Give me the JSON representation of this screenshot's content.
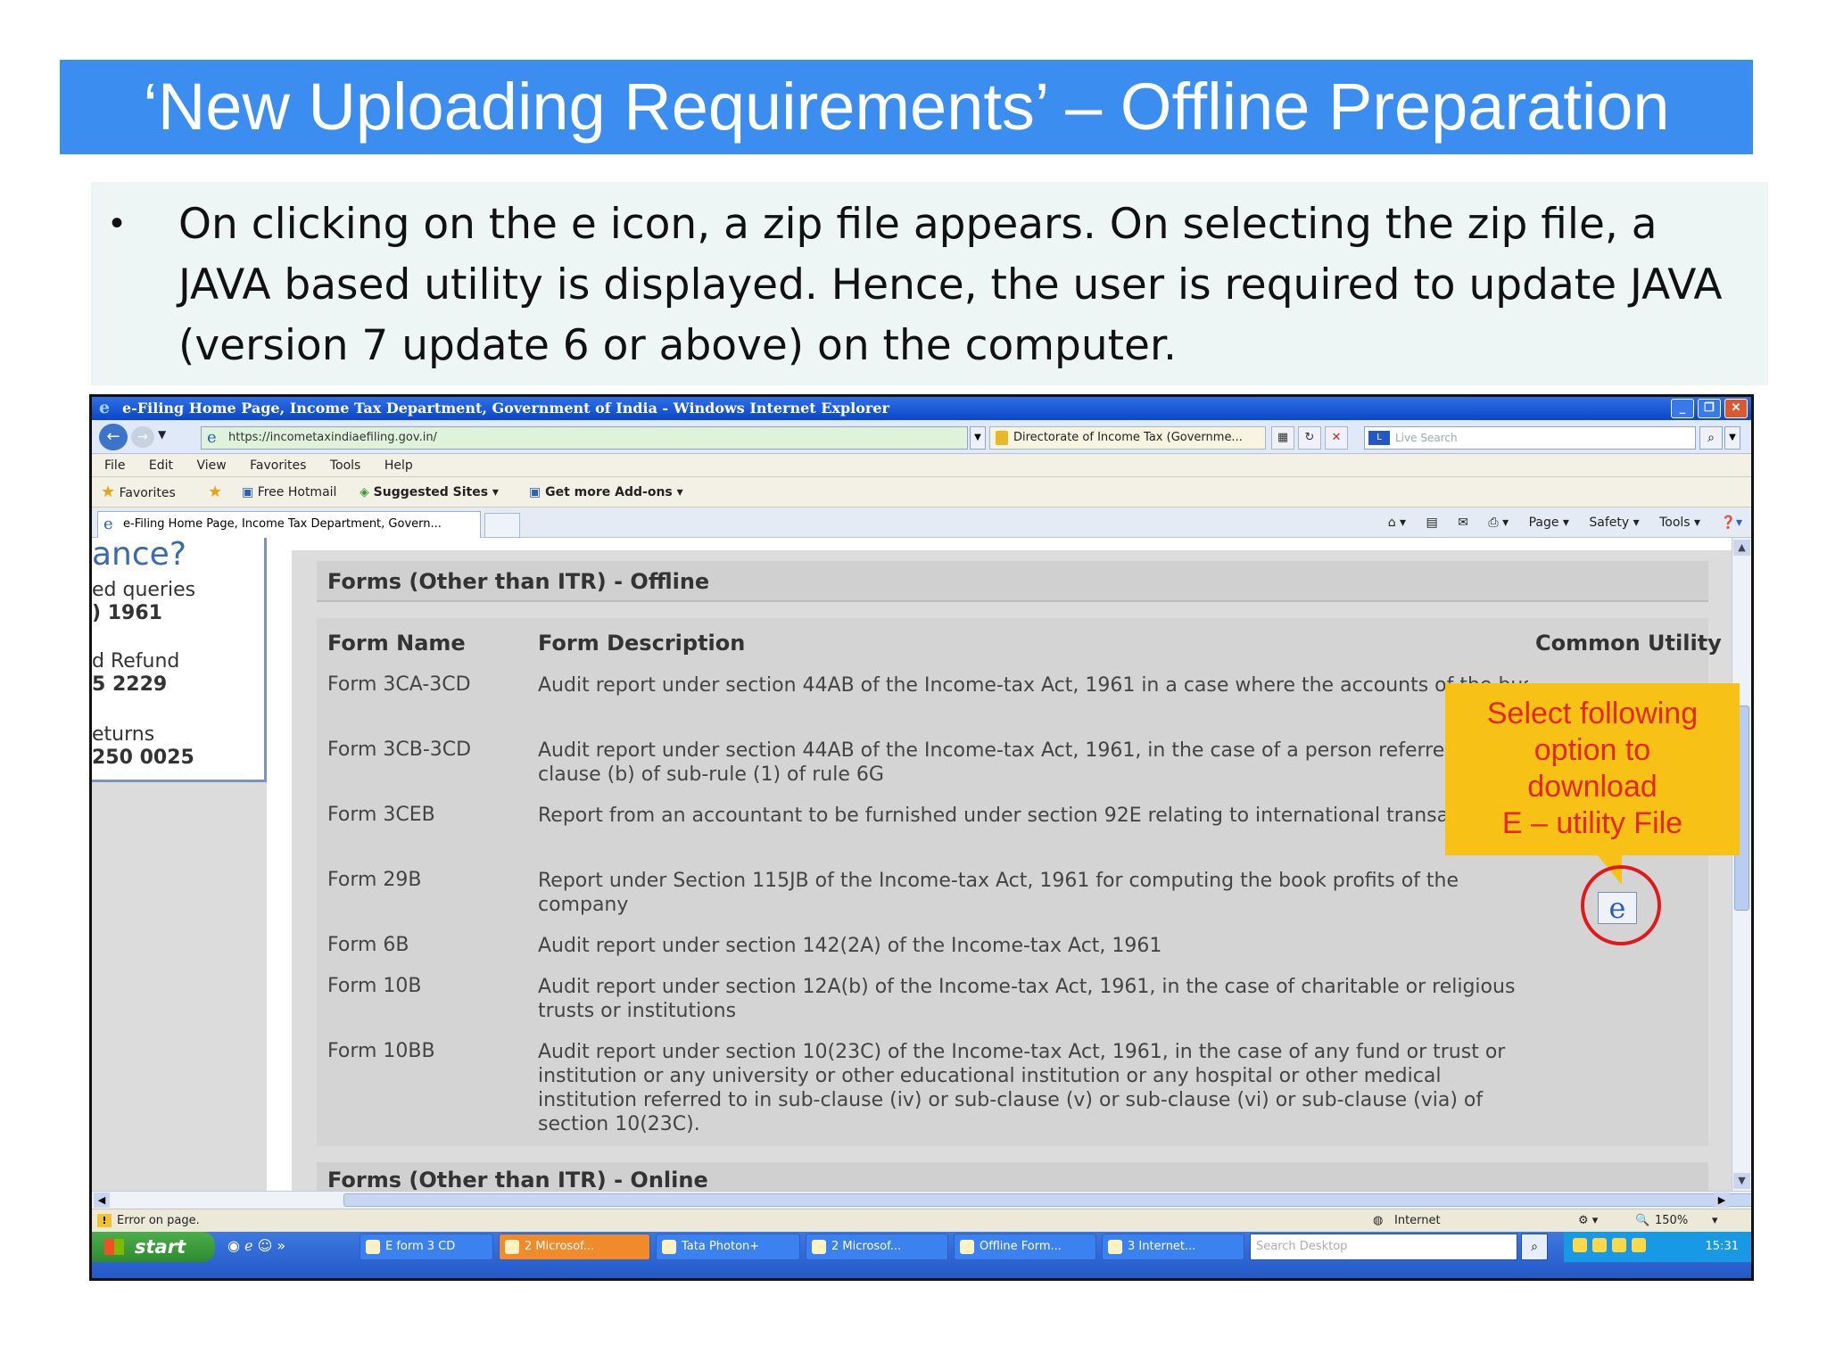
{
  "slide": {
    "title": "‘New Uploading Requirements’ – Offline Preparation",
    "bullet": "On clicking on the e icon, a zip file appears. On selecting the zip file, a JAVA based utility is displayed. Hence, the user is required to update JAVA (version 7 update 6 or above) on the computer."
  },
  "browser": {
    "window_title": "e-Filing Home Page, Income Tax Department, Government of India - Windows Internet Explorer",
    "address": "https://incometaxindiaefiling.gov.in/",
    "cert_label": "Directorate of Income Tax (Governme...",
    "live_search_placeholder": "Live Search",
    "menu": [
      "File",
      "Edit",
      "View",
      "Favorites",
      "Tools",
      "Help"
    ],
    "favorites_label": "Favorites",
    "fav_links": [
      "Free Hotmail",
      "Suggested Sites ▾",
      "Get more Add-ons ▾"
    ],
    "tab_label": "e-Filing Home Page, Income Tax Department, Govern...",
    "command_items": [
      "Page ▾",
      "Safety ▾",
      "Tools ▾"
    ],
    "status_text": "Error on page.",
    "zone_label": "Internet",
    "zoom": "150%"
  },
  "left_panel": {
    "heading": "ance?",
    "lines": [
      "ed queries",
      ") 1961",
      "d Refund",
      "5 2229",
      "eturns",
      "250 0025"
    ]
  },
  "page": {
    "section_title": "Forms (Other than ITR) - Offline",
    "columns": [
      "Form Name",
      "Form Description",
      "Common Utility"
    ],
    "rows": [
      {
        "name": "Form 3CA-3CD",
        "desc": "Audit report under section 44AB of the Income-tax Act, 1961 in a case where the accounts of the business or profession of a person have been audited under any othe"
      },
      {
        "name": "Form 3CB-3CD",
        "desc": "Audit report under section 44AB of the Income-tax Act, 1961, in the case of a person referred to in clause (b) of sub-rule (1) of rule 6G"
      },
      {
        "name": "Form 3CEB",
        "desc": "Report from an accountant to be furnished under section 92E relating to international transaction(s)"
      },
      {
        "name": "Form 29B",
        "desc": "Report under Section 115JB of the Income-tax Act, 1961 for computing the book profits of the company"
      },
      {
        "name": "Form 6B",
        "desc": "Audit report under section 142(2A) of the Income-tax Act, 1961"
      },
      {
        "name": "Form 10B",
        "desc": "Audit report under section 12A(b) of the Income-tax Act, 1961, in the case of charitable or religious trusts or institutions"
      },
      {
        "name": "Form 10BB",
        "desc": "Audit report under section 10(23C) of the Income-tax Act, 1961, in the case of any fund or trust or institution or any university or other educational institution or any hospital or other medical institution referred to in sub-clause (iv) or sub-clause (v) or sub-clause (vi) or sub-clause (via) of section 10(23C)."
      }
    ],
    "next_section_partial": "Forms (Other than ITR) - Online"
  },
  "callout": {
    "lines": [
      "Select following",
      "option to",
      "download",
      "E – utility File"
    ]
  },
  "taskbar": {
    "start": "start",
    "buttons": [
      "E form 3 CD",
      "2 Microsof...",
      "Tata Photon+",
      "2 Microsof...",
      "Offline Form...",
      "3 Internet..."
    ],
    "search_placeholder": "Search Desktop",
    "clock": "15:31"
  },
  "colors": {
    "title_bar": "#3c8df0",
    "callout_bg": "#f7c215",
    "callout_text": "#e4281c",
    "ring": "#e01a1a"
  }
}
